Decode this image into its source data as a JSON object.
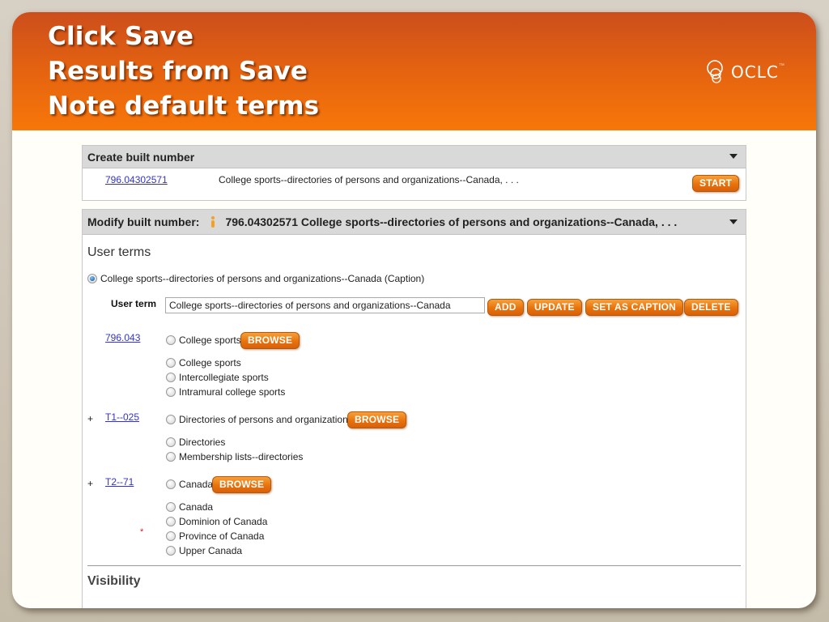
{
  "slide": {
    "title_lines": [
      "Click Save",
      "Results from Save",
      "Note default terms"
    ],
    "logo": {
      "text": "OCLC",
      "tm": "™",
      "icon": "oclc-logo-icon"
    }
  },
  "create_panel": {
    "title": "Create built number",
    "number_link": "796.04302571",
    "description": "College sports--directories of persons and organizations--Canada, . . .",
    "start_label": "START"
  },
  "modify_panel": {
    "label": "Modify built number:",
    "icon": "info-person-icon",
    "summary": "796.04302571 College sports--directories of persons and organizations--Canada, . . .",
    "user_terms_heading": "User terms",
    "caption_option": "College sports--directories of persons and organizations--Canada  (Caption)",
    "user_term_label": "User term",
    "user_term_value": "College sports--directories of persons and organizations--Canada",
    "buttons": {
      "add": "ADD",
      "update": "UPDATE",
      "set_caption": "SET AS CAPTION",
      "delete": "DELETE"
    },
    "browse_label": "BROWSE",
    "groups": [
      {
        "prefix": "",
        "link": "796.043",
        "primary": "College sports",
        "terms": [
          "College sports",
          "Intercollegiate sports",
          "Intramural college sports"
        ]
      },
      {
        "prefix": "+",
        "link": "T1--025",
        "primary": "Directories of persons and organizations",
        "terms": [
          "Directories",
          "Membership lists--directories"
        ]
      },
      {
        "prefix": "+",
        "link": "T2--71",
        "primary": "Canada",
        "terms": [
          "Canada",
          "Dominion of Canada",
          "Province of Canada",
          "Upper Canada"
        ],
        "marker": "*"
      }
    ],
    "visibility_heading": "Visibility"
  }
}
